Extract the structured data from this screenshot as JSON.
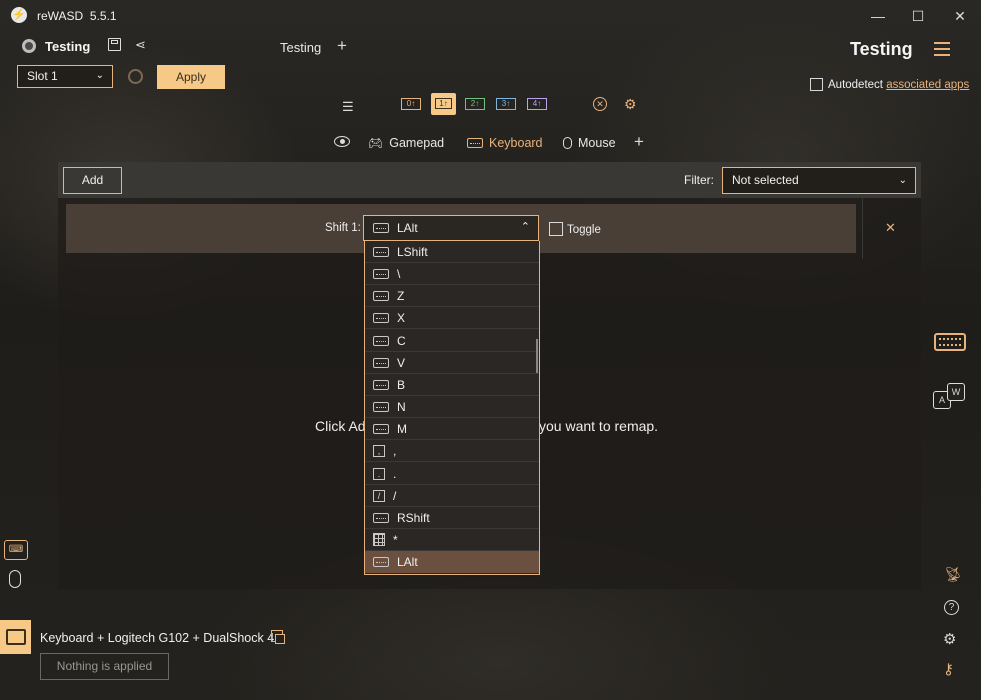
{
  "app": {
    "name": "reWASD",
    "version": "5.5.1"
  },
  "window": {
    "minimize": "—",
    "maximize": "☐",
    "close": "✕"
  },
  "config": {
    "name": "Testing",
    "tab_label": "Testing",
    "add_tab": "+",
    "header_title": "Testing"
  },
  "slot": {
    "selected": "Slot 1"
  },
  "apply_label": "Apply",
  "autodetect": {
    "label": "Autodetect",
    "link": "associated apps",
    "checked": false
  },
  "modes": [
    "Gamepad",
    "Keyboard",
    "Mouse"
  ],
  "mode_add": "+",
  "add_label": "Add",
  "filter": {
    "label": "Filter:",
    "selected": "Not selected"
  },
  "shift": {
    "label": "Shift 1:",
    "selected": "LAlt",
    "toggle_label": "Toggle",
    "toggle_checked": false
  },
  "dropdown": {
    "items": [
      {
        "label": "LShift",
        "icon": "keyboard"
      },
      {
        "label": "\\",
        "icon": "keyboard"
      },
      {
        "label": "Z",
        "icon": "keyboard"
      },
      {
        "label": "X",
        "icon": "keyboard"
      },
      {
        "label": "C",
        "icon": "keyboard"
      },
      {
        "label": "V",
        "icon": "keyboard"
      },
      {
        "label": "B",
        "icon": "keyboard"
      },
      {
        "label": "N",
        "icon": "keyboard"
      },
      {
        "label": "M",
        "icon": "keyboard"
      },
      {
        "label": ",",
        "icon": "key",
        "glyph": ","
      },
      {
        "label": ".",
        "icon": "key",
        "glyph": "."
      },
      {
        "label": "/",
        "icon": "key",
        "glyph": "/"
      },
      {
        "label": "RShift",
        "icon": "keyboard"
      },
      {
        "label": "*",
        "icon": "numpad"
      },
      {
        "label": "LAlt",
        "icon": "keyboard",
        "selected": true
      }
    ]
  },
  "hint": {
    "left": "Click Ad",
    "right": "you want to remap."
  },
  "device": {
    "name": "Keyboard + Logitech G102 + DualShock 4",
    "status": "Nothing is applied"
  },
  "colors": {
    "accent": "#e8b27c",
    "apply_bg": "#f7c987",
    "selected_row": "#6b5040",
    "panel": "#2e2c29",
    "shift_row": "#4a3f36"
  }
}
